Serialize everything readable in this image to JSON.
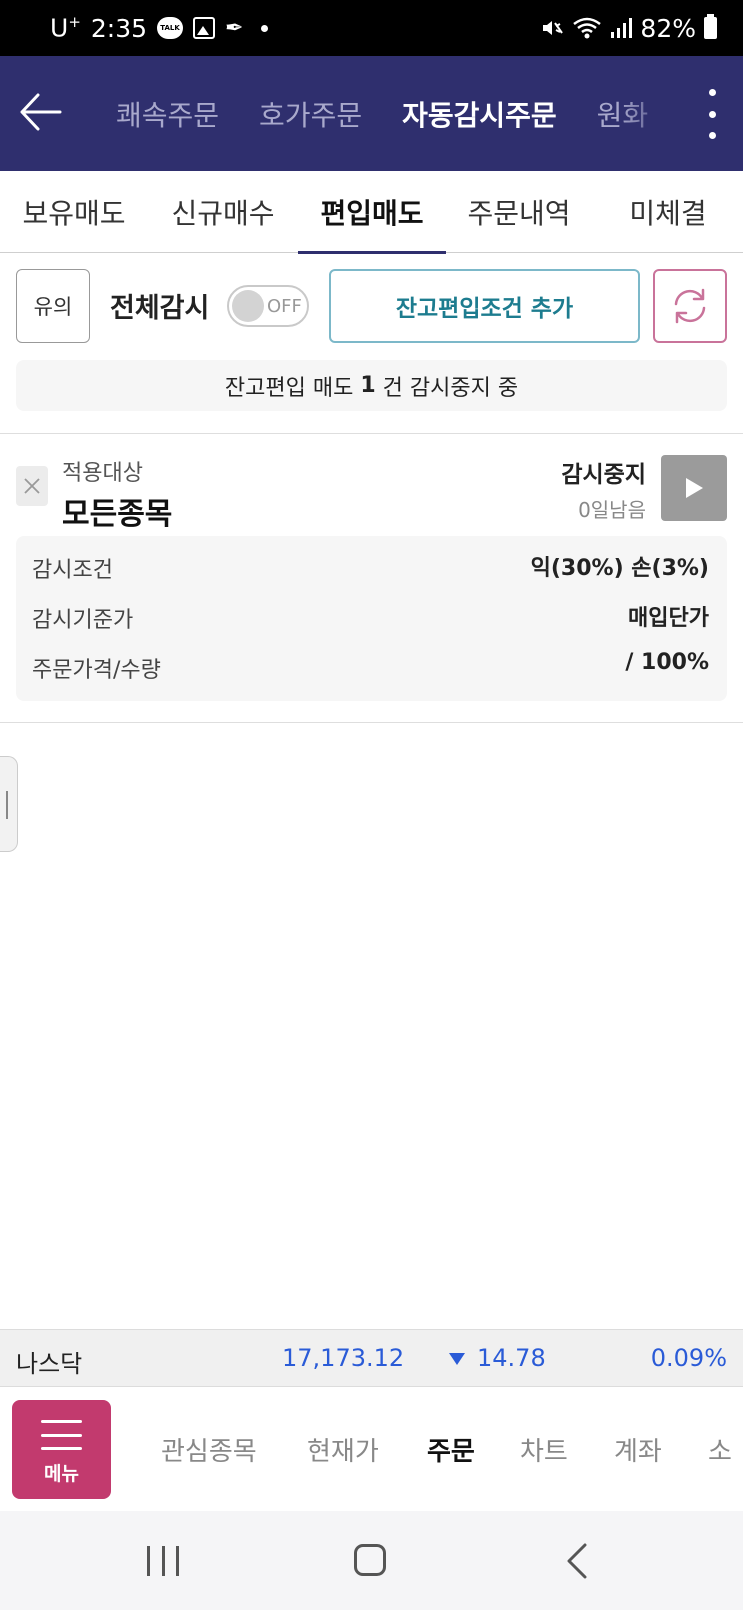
{
  "status_bar": {
    "carrier": "U",
    "carrier_sup": "+",
    "time": "2:35",
    "talk_badge": "TALK",
    "battery": "82%"
  },
  "header": {
    "tabs": [
      {
        "label": "쾌속주문"
      },
      {
        "label": "호가주문"
      },
      {
        "label": "자동감시주문"
      },
      {
        "label": "원화"
      }
    ],
    "active_tab": "자동감시주문"
  },
  "sub_tabs": [
    {
      "label": "보유매도"
    },
    {
      "label": "신규매수"
    },
    {
      "label": "편입매도"
    },
    {
      "label": "주문내역"
    },
    {
      "label": "미체결"
    }
  ],
  "controls": {
    "caution_label": "유의",
    "all_monitor_label": "전체감시",
    "toggle_state": "OFF",
    "add_condition_label": "잔고편입조건 추가"
  },
  "summary": {
    "prefix": "잔고편입 매도 ",
    "count": "1",
    "suffix": " 건 감시중지 중"
  },
  "condition_card": {
    "target_label": "적용대상",
    "target_value": "모든종목",
    "status": "감시중지",
    "days_remaining": "0일남음",
    "rows": [
      {
        "label": "감시조건",
        "value": "익(30%) 손(3%)"
      },
      {
        "label": "감시기준가",
        "value": "매입단가"
      },
      {
        "label": "주문가격/수량",
        "value": "/ 100%"
      }
    ]
  },
  "ticker": {
    "name": "나스닥",
    "price": "17,173.12",
    "change": "14.78",
    "rate": "0.09%",
    "direction": "down",
    "color": "#2a5bd7"
  },
  "bottom_menu": {
    "menu_label": "메뉴",
    "items": [
      {
        "label": "관심종목"
      },
      {
        "label": "현재가"
      },
      {
        "label": "주문"
      },
      {
        "label": "차트"
      },
      {
        "label": "계좌"
      },
      {
        "label": "소"
      }
    ],
    "active_item": "주문"
  },
  "colors": {
    "header_bg": "#2f2f6e",
    "menu_accent": "#c23a6e",
    "add_button_text": "#1d7c8f",
    "play_button": "#9b9b9b"
  }
}
